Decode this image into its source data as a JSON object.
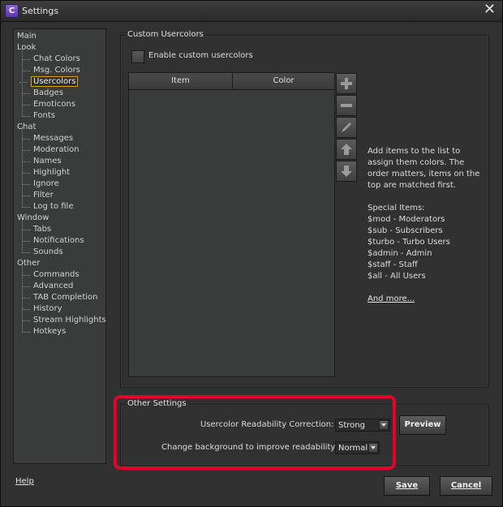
{
  "window": {
    "title": "Settings",
    "app_icon_letter": "C"
  },
  "sidebar": {
    "items": [
      {
        "label": "Main",
        "level": 0
      },
      {
        "label": "Look",
        "level": 0
      },
      {
        "label": "Chat Colors",
        "level": 1
      },
      {
        "label": "Msg. Colors",
        "level": 1
      },
      {
        "label": "Usercolors",
        "level": 1,
        "selected": true
      },
      {
        "label": "Badges",
        "level": 1
      },
      {
        "label": "Emoticons",
        "level": 1
      },
      {
        "label": "Fonts",
        "level": 1
      },
      {
        "label": "Chat",
        "level": 0
      },
      {
        "label": "Messages",
        "level": 1
      },
      {
        "label": "Moderation",
        "level": 1
      },
      {
        "label": "Names",
        "level": 1
      },
      {
        "label": "Highlight",
        "level": 1
      },
      {
        "label": "Ignore",
        "level": 1
      },
      {
        "label": "Filter",
        "level": 1
      },
      {
        "label": "Log to file",
        "level": 1
      },
      {
        "label": "Window",
        "level": 0
      },
      {
        "label": "Tabs",
        "level": 1
      },
      {
        "label": "Notifications",
        "level": 1
      },
      {
        "label": "Sounds",
        "level": 1
      },
      {
        "label": "Other",
        "level": 0
      },
      {
        "label": "Commands",
        "level": 1
      },
      {
        "label": "Advanced",
        "level": 1
      },
      {
        "label": "TAB Completion",
        "level": 1
      },
      {
        "label": "History",
        "level": 1
      },
      {
        "label": "Stream Highlights",
        "level": 1
      },
      {
        "label": "Hotkeys",
        "level": 1
      }
    ]
  },
  "custom_usercolors": {
    "title": "Custom Usercolors",
    "enable_label": "Enable custom usercolors",
    "enabled": false,
    "columns": [
      "Item",
      "Color"
    ],
    "rows": [],
    "buttons": [
      "add-icon",
      "remove-icon",
      "edit-icon",
      "move-up-icon",
      "move-down-icon"
    ],
    "help_lines": [
      "Add items to the list to",
      "assign them colors. The",
      "order matters, items on the",
      "top are matched first.",
      "",
      "Special Items:",
      "$mod - Moderators",
      "$sub - Subscribers",
      "$turbo - Turbo Users",
      "$admin - Admin",
      "$staff - Staff",
      "$all - All Users"
    ],
    "more_link": "And more..."
  },
  "other_settings": {
    "title": "Other Settings",
    "readability_label": "Usercolor Readability Correction:",
    "readability_value": "Strong",
    "preview_label": "Preview",
    "background_label": "Change background to improve readability:",
    "background_value": "Normal"
  },
  "footer": {
    "help_label": "Help",
    "save_label": "Save",
    "cancel_label": "Cancel"
  },
  "colors": {
    "highlight": "#e4002b",
    "selection": "#d6a400"
  }
}
